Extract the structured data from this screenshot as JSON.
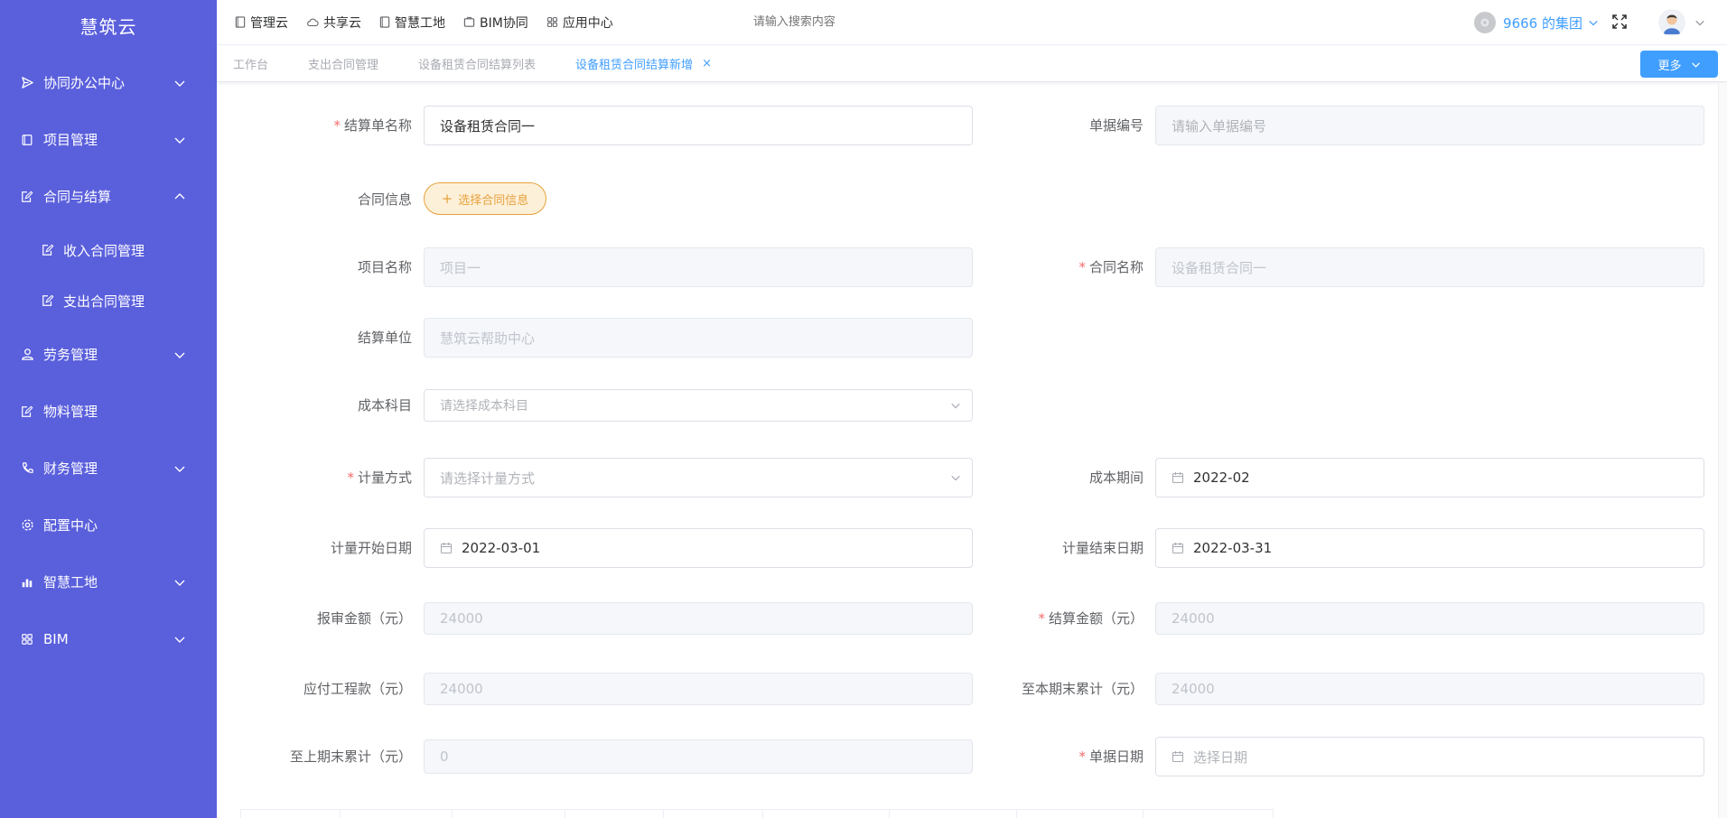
{
  "app": {
    "brand": "慧筑云"
  },
  "sidebar": {
    "items": [
      {
        "label": "协同办公中心",
        "icon": "send-icon",
        "expandable": true,
        "expanded": false
      },
      {
        "label": "项目管理",
        "icon": "book-icon",
        "expandable": true,
        "expanded": false
      },
      {
        "label": "合同与结算",
        "icon": "edit-doc-icon",
        "expandable": true,
        "expanded": true,
        "children": [
          {
            "label": "收入合同管理",
            "icon": "edit-doc-icon"
          },
          {
            "label": "支出合同管理",
            "icon": "edit-doc-icon"
          }
        ]
      },
      {
        "label": "劳务管理",
        "icon": "user-icon",
        "expandable": true,
        "expanded": false
      },
      {
        "label": "物料管理",
        "icon": "edit-doc-icon",
        "expandable": false
      },
      {
        "label": "财务管理",
        "icon": "phone-icon",
        "expandable": true,
        "expanded": false
      },
      {
        "label": "配置中心",
        "icon": "gear-icon",
        "expandable": false
      },
      {
        "label": "智慧工地",
        "icon": "bar-chart-icon",
        "expandable": true,
        "expanded": false
      },
      {
        "label": "BIM",
        "icon": "grid-icon",
        "expandable": true,
        "expanded": false
      }
    ]
  },
  "topbar": {
    "nav": [
      {
        "label": "管理云",
        "icon": "tablet-icon"
      },
      {
        "label": "共享云",
        "icon": "cloud-icon"
      },
      {
        "label": "智慧工地",
        "icon": "tablet-icon"
      },
      {
        "label": "BIM协同",
        "icon": "box-icon"
      },
      {
        "label": "应用中心",
        "icon": "grid-icon"
      }
    ],
    "search_placeholder": "请输入搜索内容",
    "org_name": "9666 的集团"
  },
  "tabs": {
    "items": [
      {
        "label": "工作台",
        "active": false
      },
      {
        "label": "支出合同管理",
        "active": false
      },
      {
        "label": "设备租赁合同结算列表",
        "active": false
      },
      {
        "label": "设备租赁合同结算新增",
        "active": true,
        "closable": true
      }
    ],
    "close_symbol": "×",
    "more_label": "更多"
  },
  "form": {
    "settlement_name": {
      "label": "结算单名称",
      "required": true,
      "value": "设备租赁合同一"
    },
    "doc_number": {
      "label": "单据编号",
      "required": false,
      "placeholder": "请输入单据编号"
    },
    "contract_info": {
      "label": "合同信息",
      "button_label": "选择合同信息"
    },
    "project_name": {
      "label": "项目名称",
      "required": false,
      "value": "项目一"
    },
    "contract_name": {
      "label": "合同名称",
      "required": true,
      "value": "设备租赁合同一"
    },
    "settlement_unit": {
      "label": "结算单位",
      "required": false,
      "value": "慧筑云帮助中心"
    },
    "cost_subject": {
      "label": "成本科目",
      "required": false,
      "placeholder": "请选择成本科目"
    },
    "measure_method": {
      "label": "计量方式",
      "required": true,
      "placeholder": "请选择计量方式"
    },
    "cost_period": {
      "label": "成本期间",
      "required": false,
      "value": "2022-02"
    },
    "measure_start": {
      "label": "计量开始日期",
      "required": false,
      "value": "2022-03-01"
    },
    "measure_end": {
      "label": "计量结束日期",
      "required": false,
      "value": "2022-03-31"
    },
    "reported_amount": {
      "label": "报审金额（元）",
      "required": false,
      "value": "24000"
    },
    "settlement_amount": {
      "label": "结算金额（元）",
      "required": true,
      "value": "24000"
    },
    "payable": {
      "label": "应付工程款（元）",
      "required": false,
      "value": "24000"
    },
    "cum_this_period": {
      "label": "至本期末累计（元）",
      "required": false,
      "value": "24000"
    },
    "cum_last_period": {
      "label": "至上期末累计（元）",
      "required": false,
      "value": "0"
    },
    "doc_date": {
      "label": "单据日期",
      "required": true,
      "placeholder": "选择日期"
    }
  },
  "colors": {
    "sidebar_bg": "#5a5fdc",
    "primary": "#409eff",
    "required": "#f56c6c",
    "warning": "#e6a23c"
  }
}
